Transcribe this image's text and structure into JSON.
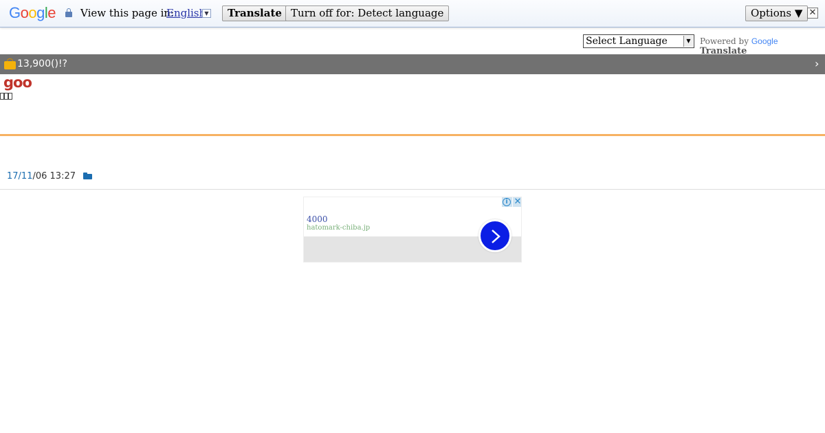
{
  "translate_bar": {
    "logo": {
      "letters": [
        "G",
        "o",
        "o",
        "g",
        "l",
        "e"
      ],
      "colors": [
        "#4285F4",
        "#EA4335",
        "#FBBC05",
        "#4285F4",
        "#34A853",
        "#EA4335"
      ]
    },
    "view_label": "View this page in:",
    "language": "English",
    "translate_button": "Translate",
    "turn_off_button": "Turn off for: Detect language",
    "options_button": "Options ▼",
    "close": "✕"
  },
  "widget": {
    "select_language": "Select Language",
    "powered_by": "Powered by",
    "google": "Google",
    "translate": "Translate"
  },
  "headline": {
    "text": "13,900()!?",
    "chevron": "›"
  },
  "blog": {
    "logo": "goo",
    "date_link": "17/11",
    "date_rest": "/06 13:27"
  },
  "ad": {
    "number": "4000",
    "domain": "hatomark-chiba.jp",
    "info": "i",
    "close": "✕",
    "colors": {
      "button": "#0b1ee5"
    }
  },
  "colors": {
    "headline_bar": "#717171",
    "accent_line": "#f7b262",
    "logo_red": "#c0342b",
    "link_blue": "#1b6db0"
  }
}
